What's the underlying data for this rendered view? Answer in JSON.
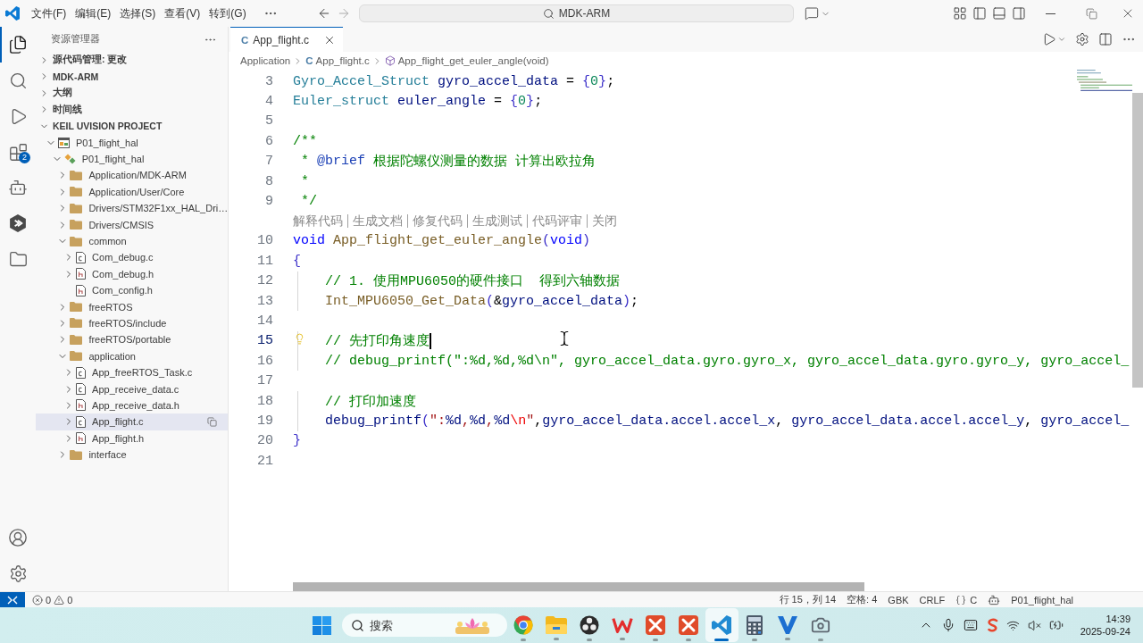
{
  "title_bar": {
    "menu": [
      "文件(F)",
      "编辑(E)",
      "选择(S)",
      "查看(V)",
      "转到(G)"
    ],
    "command_center": "MDK-ARM"
  },
  "activity_bar": {
    "top": [
      {
        "kind": "explorer",
        "selected": true
      },
      {
        "kind": "search",
        "selected": false
      },
      {
        "kind": "run",
        "selected": false
      },
      {
        "kind": "extensions",
        "selected": false,
        "badge": "2"
      },
      {
        "kind": "assistant",
        "selected": false
      },
      {
        "kind": "hexagon",
        "selected": false
      },
      {
        "kind": "folder",
        "selected": false
      }
    ],
    "bottom": [
      {
        "kind": "account"
      },
      {
        "kind": "settings"
      }
    ]
  },
  "sidebar": {
    "title": "资源管理器",
    "sections": [
      {
        "label": "源代码管理: 更改",
        "expanded": false
      },
      {
        "label": "MDK-ARM",
        "expanded": false
      },
      {
        "label": "大纲",
        "expanded": false
      },
      {
        "label": "时间线",
        "expanded": false
      },
      {
        "label": "KEIL UVISION PROJECT",
        "expanded": true,
        "tree": [
          {
            "label": "P01_flight_hal",
            "kind": "project",
            "expandable": true,
            "expanded": true,
            "selected": false,
            "children": [
              {
                "label": "P01_flight_hal",
                "kind": "target",
                "expandable": true,
                "expanded": true,
                "selected": false,
                "children": [
                  {
                    "label": "Application/MDK-ARM",
                    "kind": "folder",
                    "expandable": true,
                    "expanded": false,
                    "selected": false
                  },
                  {
                    "label": "Application/User/Core",
                    "kind": "folder",
                    "expandable": true,
                    "expanded": false,
                    "selected": false
                  },
                  {
                    "label": "Drivers/STM32F1xx_HAL_Dri…",
                    "kind": "folder",
                    "expandable": true,
                    "expanded": false,
                    "selected": false
                  },
                  {
                    "label": "Drivers/CMSIS",
                    "kind": "folder",
                    "expandable": true,
                    "expanded": false,
                    "selected": false
                  },
                  {
                    "label": "common",
                    "kind": "folder",
                    "expandable": true,
                    "expanded": true,
                    "selected": false,
                    "children": [
                      {
                        "label": "Com_debug.c",
                        "kind": "source",
                        "expandable": true,
                        "expanded": false,
                        "selected": false
                      },
                      {
                        "label": "Com_debug.h",
                        "kind": "header",
                        "expandable": true,
                        "expanded": false,
                        "selected": false
                      },
                      {
                        "label": "Com_config.h",
                        "kind": "header",
                        "expandable": false,
                        "expanded": false,
                        "selected": false
                      }
                    ]
                  },
                  {
                    "label": "freeRTOS",
                    "kind": "folder",
                    "expandable": true,
                    "expanded": false,
                    "selected": false
                  },
                  {
                    "label": "freeRTOS/include",
                    "kind": "folder",
                    "expandable": true,
                    "expanded": false,
                    "selected": false
                  },
                  {
                    "label": "freeRTOS/portable",
                    "kind": "folder",
                    "expandable": true,
                    "expanded": false,
                    "selected": false
                  },
                  {
                    "label": "application",
                    "kind": "folder",
                    "expandable": true,
                    "expanded": true,
                    "selected": false,
                    "children": [
                      {
                        "label": "App_freeRTOS_Task.c",
                        "kind": "source",
                        "expandable": true,
                        "expanded": false,
                        "selected": false
                      },
                      {
                        "label": "App_receive_data.c",
                        "kind": "source",
                        "expandable": true,
                        "expanded": false,
                        "selected": false
                      },
                      {
                        "label": "App_receive_data.h",
                        "kind": "header",
                        "expandable": true,
                        "expanded": false,
                        "selected": false
                      },
                      {
                        "label": "App_flight.c",
                        "kind": "source",
                        "expandable": true,
                        "expanded": false,
                        "selected": true
                      },
                      {
                        "label": "App_flight.h",
                        "kind": "header",
                        "expandable": true,
                        "expanded": false,
                        "selected": false
                      }
                    ]
                  },
                  {
                    "label": "interface",
                    "kind": "folder",
                    "expandable": true,
                    "expanded": false,
                    "selected": false
                  }
                ]
              }
            ]
          }
        ]
      }
    ]
  },
  "editor": {
    "tabs": [
      {
        "label": "App_flight.c",
        "icon_text": "C",
        "selected": true
      }
    ],
    "breadcrumbs": [
      {
        "kind": "folder",
        "label": "Application"
      },
      {
        "kind": "file",
        "icon_text": "C",
        "label": "App_flight.c"
      },
      {
        "kind": "symbol",
        "label": "App_flight_get_euler_angle(void)"
      }
    ],
    "lines": [
      {
        "kind": "code",
        "number": "3",
        "indented": false,
        "current": false,
        "lightbulb": false,
        "tokens": [
          {
            "kind": "type",
            "text": "Gyro_Accel_Struct"
          },
          {
            "kind": "variable",
            "text": " gyro_accel_data"
          },
          {
            "kind": "plain",
            "text": " = "
          },
          {
            "kind": "bracket",
            "text": "{"
          },
          {
            "kind": "number",
            "text": "0"
          },
          {
            "kind": "bracket",
            "text": "}"
          },
          {
            "kind": "plain",
            "text": ";"
          }
        ]
      },
      {
        "kind": "code",
        "number": "4",
        "indented": false,
        "current": false,
        "lightbulb": false,
        "tokens": [
          {
            "kind": "type",
            "text": "Euler_struct"
          },
          {
            "kind": "variable",
            "text": " euler_angle"
          },
          {
            "kind": "plain",
            "text": " = "
          },
          {
            "kind": "bracket",
            "text": "{"
          },
          {
            "kind": "number",
            "text": "0"
          },
          {
            "kind": "bracket",
            "text": "}"
          },
          {
            "kind": "plain",
            "text": ";"
          }
        ]
      },
      {
        "kind": "code",
        "number": "5",
        "current": false,
        "lightbulb": false
      },
      {
        "kind": "code",
        "number": "6",
        "indented": false,
        "current": false,
        "lightbulb": false,
        "tokens": [
          {
            "kind": "comment",
            "text": "/**"
          }
        ]
      },
      {
        "kind": "code",
        "number": "7",
        "indented": false,
        "current": false,
        "lightbulb": false,
        "tokens": [
          {
            "kind": "comment",
            "text": " * "
          },
          {
            "kind": "doctag",
            "text": "@brief"
          },
          {
            "kind": "comment",
            "text": " 根据陀螺仪测量的数据 计算出欧拉角"
          }
        ]
      },
      {
        "kind": "code",
        "number": "8",
        "indented": false,
        "current": false,
        "lightbulb": false,
        "tokens": [
          {
            "kind": "comment",
            "text": " *"
          }
        ]
      },
      {
        "kind": "code",
        "number": "9",
        "indented": false,
        "current": false,
        "lightbulb": false,
        "tokens": [
          {
            "kind": "comment",
            "text": " */"
          }
        ]
      },
      {
        "kind": "codelens",
        "actions": [
          "解释代码",
          "生成文档",
          "修复代码",
          "生成测试",
          "代码评审",
          "关闭"
        ]
      },
      {
        "kind": "code",
        "number": "10",
        "indented": false,
        "current": false,
        "lightbulb": false,
        "tokens": [
          {
            "kind": "keyword",
            "text": "void"
          },
          {
            "kind": "function",
            "text": " App_flight_get_euler_angle"
          },
          {
            "kind": "bracket",
            "text": "("
          },
          {
            "kind": "keyword",
            "text": "void"
          },
          {
            "kind": "bracket",
            "text": ")"
          }
        ]
      },
      {
        "kind": "code",
        "number": "11",
        "indented": false,
        "current": false,
        "lightbulb": false,
        "tokens": [
          {
            "kind": "bracket",
            "text": "{"
          }
        ]
      },
      {
        "kind": "code",
        "number": "12",
        "indented": true,
        "current": false,
        "lightbulb": false,
        "tokens": [
          {
            "kind": "comment",
            "text": "// 1. 使用MPU6050的硬件接口  得到六轴数据"
          }
        ]
      },
      {
        "kind": "code",
        "number": "13",
        "indented": true,
        "current": false,
        "lightbulb": false,
        "tokens": [
          {
            "kind": "function",
            "text": "Int_MPU6050_Get_Data"
          },
          {
            "kind": "bracket",
            "text": "("
          },
          {
            "kind": "plain",
            "text": "&"
          },
          {
            "kind": "variable",
            "text": "gyro_accel_data"
          },
          {
            "kind": "bracket",
            "text": ")"
          },
          {
            "kind": "plain",
            "text": ";"
          }
        ]
      },
      {
        "kind": "code",
        "number": "14",
        "current": false,
        "lightbulb": false
      },
      {
        "kind": "code",
        "number": "15",
        "indented": true,
        "current": true,
        "lightbulb": true,
        "tokens": [
          {
            "kind": "comment",
            "text": "// 先打印角速度"
          }
        ]
      },
      {
        "kind": "code",
        "number": "16",
        "indented": true,
        "current": false,
        "lightbulb": false,
        "tokens": [
          {
            "kind": "comment",
            "text": "// debug_printf(\":%d,%d,%d\\n\", gyro_accel_data.gyro.gyro_x, gyro_accel_data.gyro.gyro_y, gyro_accel_"
          }
        ]
      },
      {
        "kind": "code",
        "number": "17",
        "current": false,
        "lightbulb": false
      },
      {
        "kind": "code",
        "number": "18",
        "indented": true,
        "current": false,
        "lightbulb": false,
        "tokens": [
          {
            "kind": "comment",
            "text": "// 打印加速度"
          }
        ]
      },
      {
        "kind": "code",
        "number": "19",
        "indented": true,
        "current": false,
        "lightbulb": false,
        "tokens": [
          {
            "kind": "variable",
            "text": "debug_printf"
          },
          {
            "kind": "bracket",
            "text": "("
          },
          {
            "kind": "string",
            "text": "\":"
          },
          {
            "kind": "placeholder",
            "text": "%d"
          },
          {
            "kind": "string",
            "text": ","
          },
          {
            "kind": "placeholder",
            "text": "%d"
          },
          {
            "kind": "string",
            "text": ","
          },
          {
            "kind": "placeholder",
            "text": "%d"
          },
          {
            "kind": "escape",
            "text": "\\n"
          },
          {
            "kind": "string",
            "text": "\""
          },
          {
            "kind": "plain",
            "text": ","
          },
          {
            "kind": "variable",
            "text": "gyro_accel_data.accel.accel_x"
          },
          {
            "kind": "plain",
            "text": ", "
          },
          {
            "kind": "variable",
            "text": "gyro_accel_data.accel.accel_y"
          },
          {
            "kind": "plain",
            "text": ", "
          },
          {
            "kind": "variable",
            "text": "gyro_accel_"
          }
        ]
      },
      {
        "kind": "code",
        "number": "20",
        "indented": false,
        "current": false,
        "lightbulb": false,
        "tokens": [
          {
            "kind": "bracket",
            "text": "}"
          }
        ]
      },
      {
        "kind": "code",
        "number": "21",
        "current": false,
        "lightbulb": false
      }
    ]
  },
  "status_bar": {
    "errors": "0",
    "warnings": "0",
    "items": [
      {
        "kind": "text",
        "label": "行 15，列 14"
      },
      {
        "kind": "text",
        "label": "空格: 4"
      },
      {
        "kind": "text",
        "label": "GBK"
      },
      {
        "kind": "text",
        "label": "CRLF"
      },
      {
        "kind": "language",
        "label": "C"
      },
      {
        "kind": "assistant"
      },
      {
        "kind": "text",
        "label": "P01_flight_hal"
      }
    ]
  },
  "taskbar": {
    "search_placeholder": "搜索",
    "apps": [
      {
        "kind": "browser",
        "selected": false
      },
      {
        "kind": "files",
        "selected": false
      },
      {
        "kind": "recorder",
        "selected": false
      },
      {
        "kind": "office",
        "selected": false
      },
      {
        "kind": "tool",
        "selected": false
      },
      {
        "kind": "tool",
        "selected": false
      },
      {
        "kind": "editor",
        "selected": true
      },
      {
        "kind": "calculator",
        "selected": false
      },
      {
        "kind": "vapp",
        "selected": false
      },
      {
        "kind": "camera",
        "selected": false
      }
    ],
    "time": "14:39",
    "date": "2025-09-24"
  }
}
